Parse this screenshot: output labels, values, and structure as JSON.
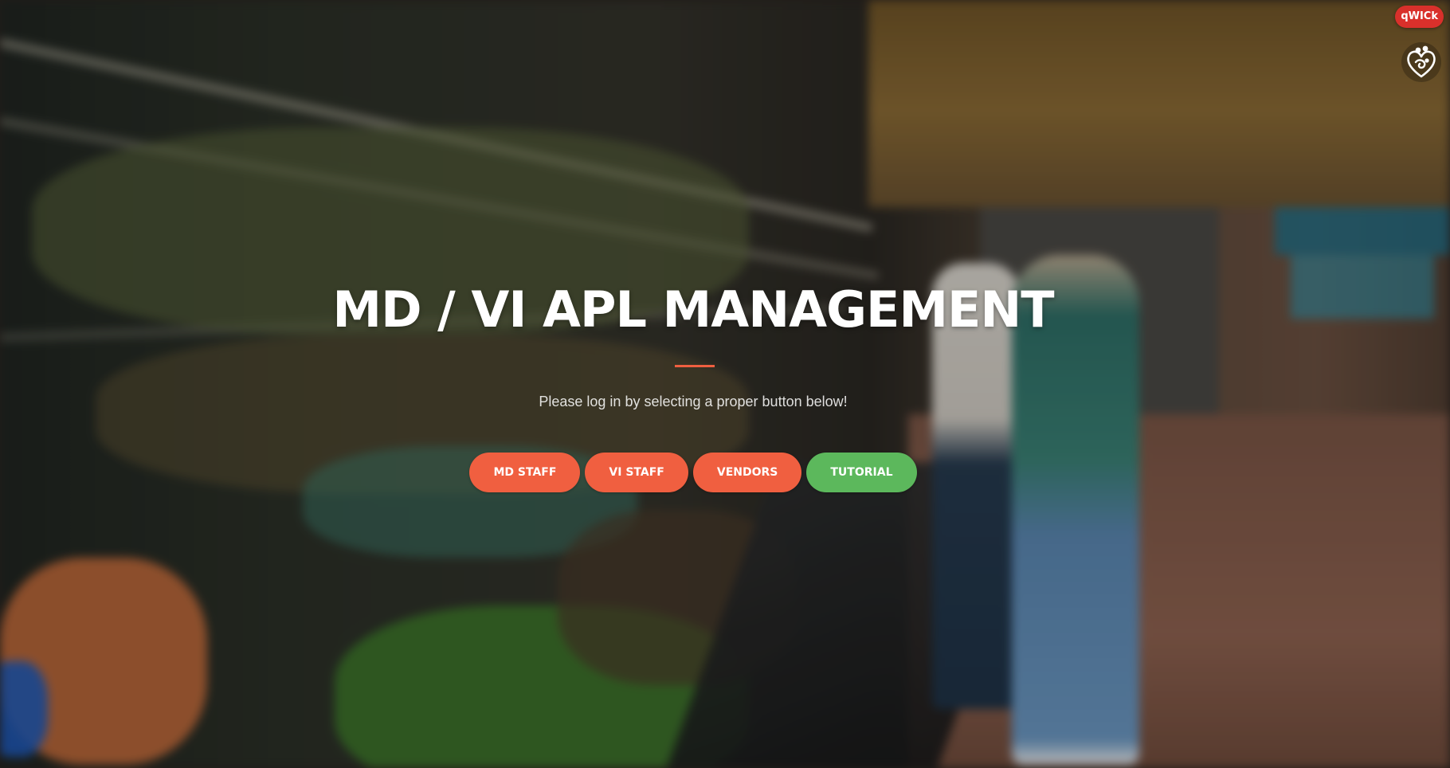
{
  "hero": {
    "title": "MD / VI APL MANAGEMENT",
    "subtitle": "Please log in by selecting a proper button below!"
  },
  "buttons": {
    "md_staff": "MD STAFF",
    "vi_staff": "VI STAFF",
    "vendors": "VENDORS",
    "tutorial": "TUTORIAL"
  },
  "badge": {
    "label": "qWICk"
  },
  "icons": {
    "corner_logo": "family-heart-icon"
  },
  "colors": {
    "primary": "#f05f40",
    "success": "#5cb85c",
    "badge": "#d9302b",
    "title": "#ffffff"
  }
}
